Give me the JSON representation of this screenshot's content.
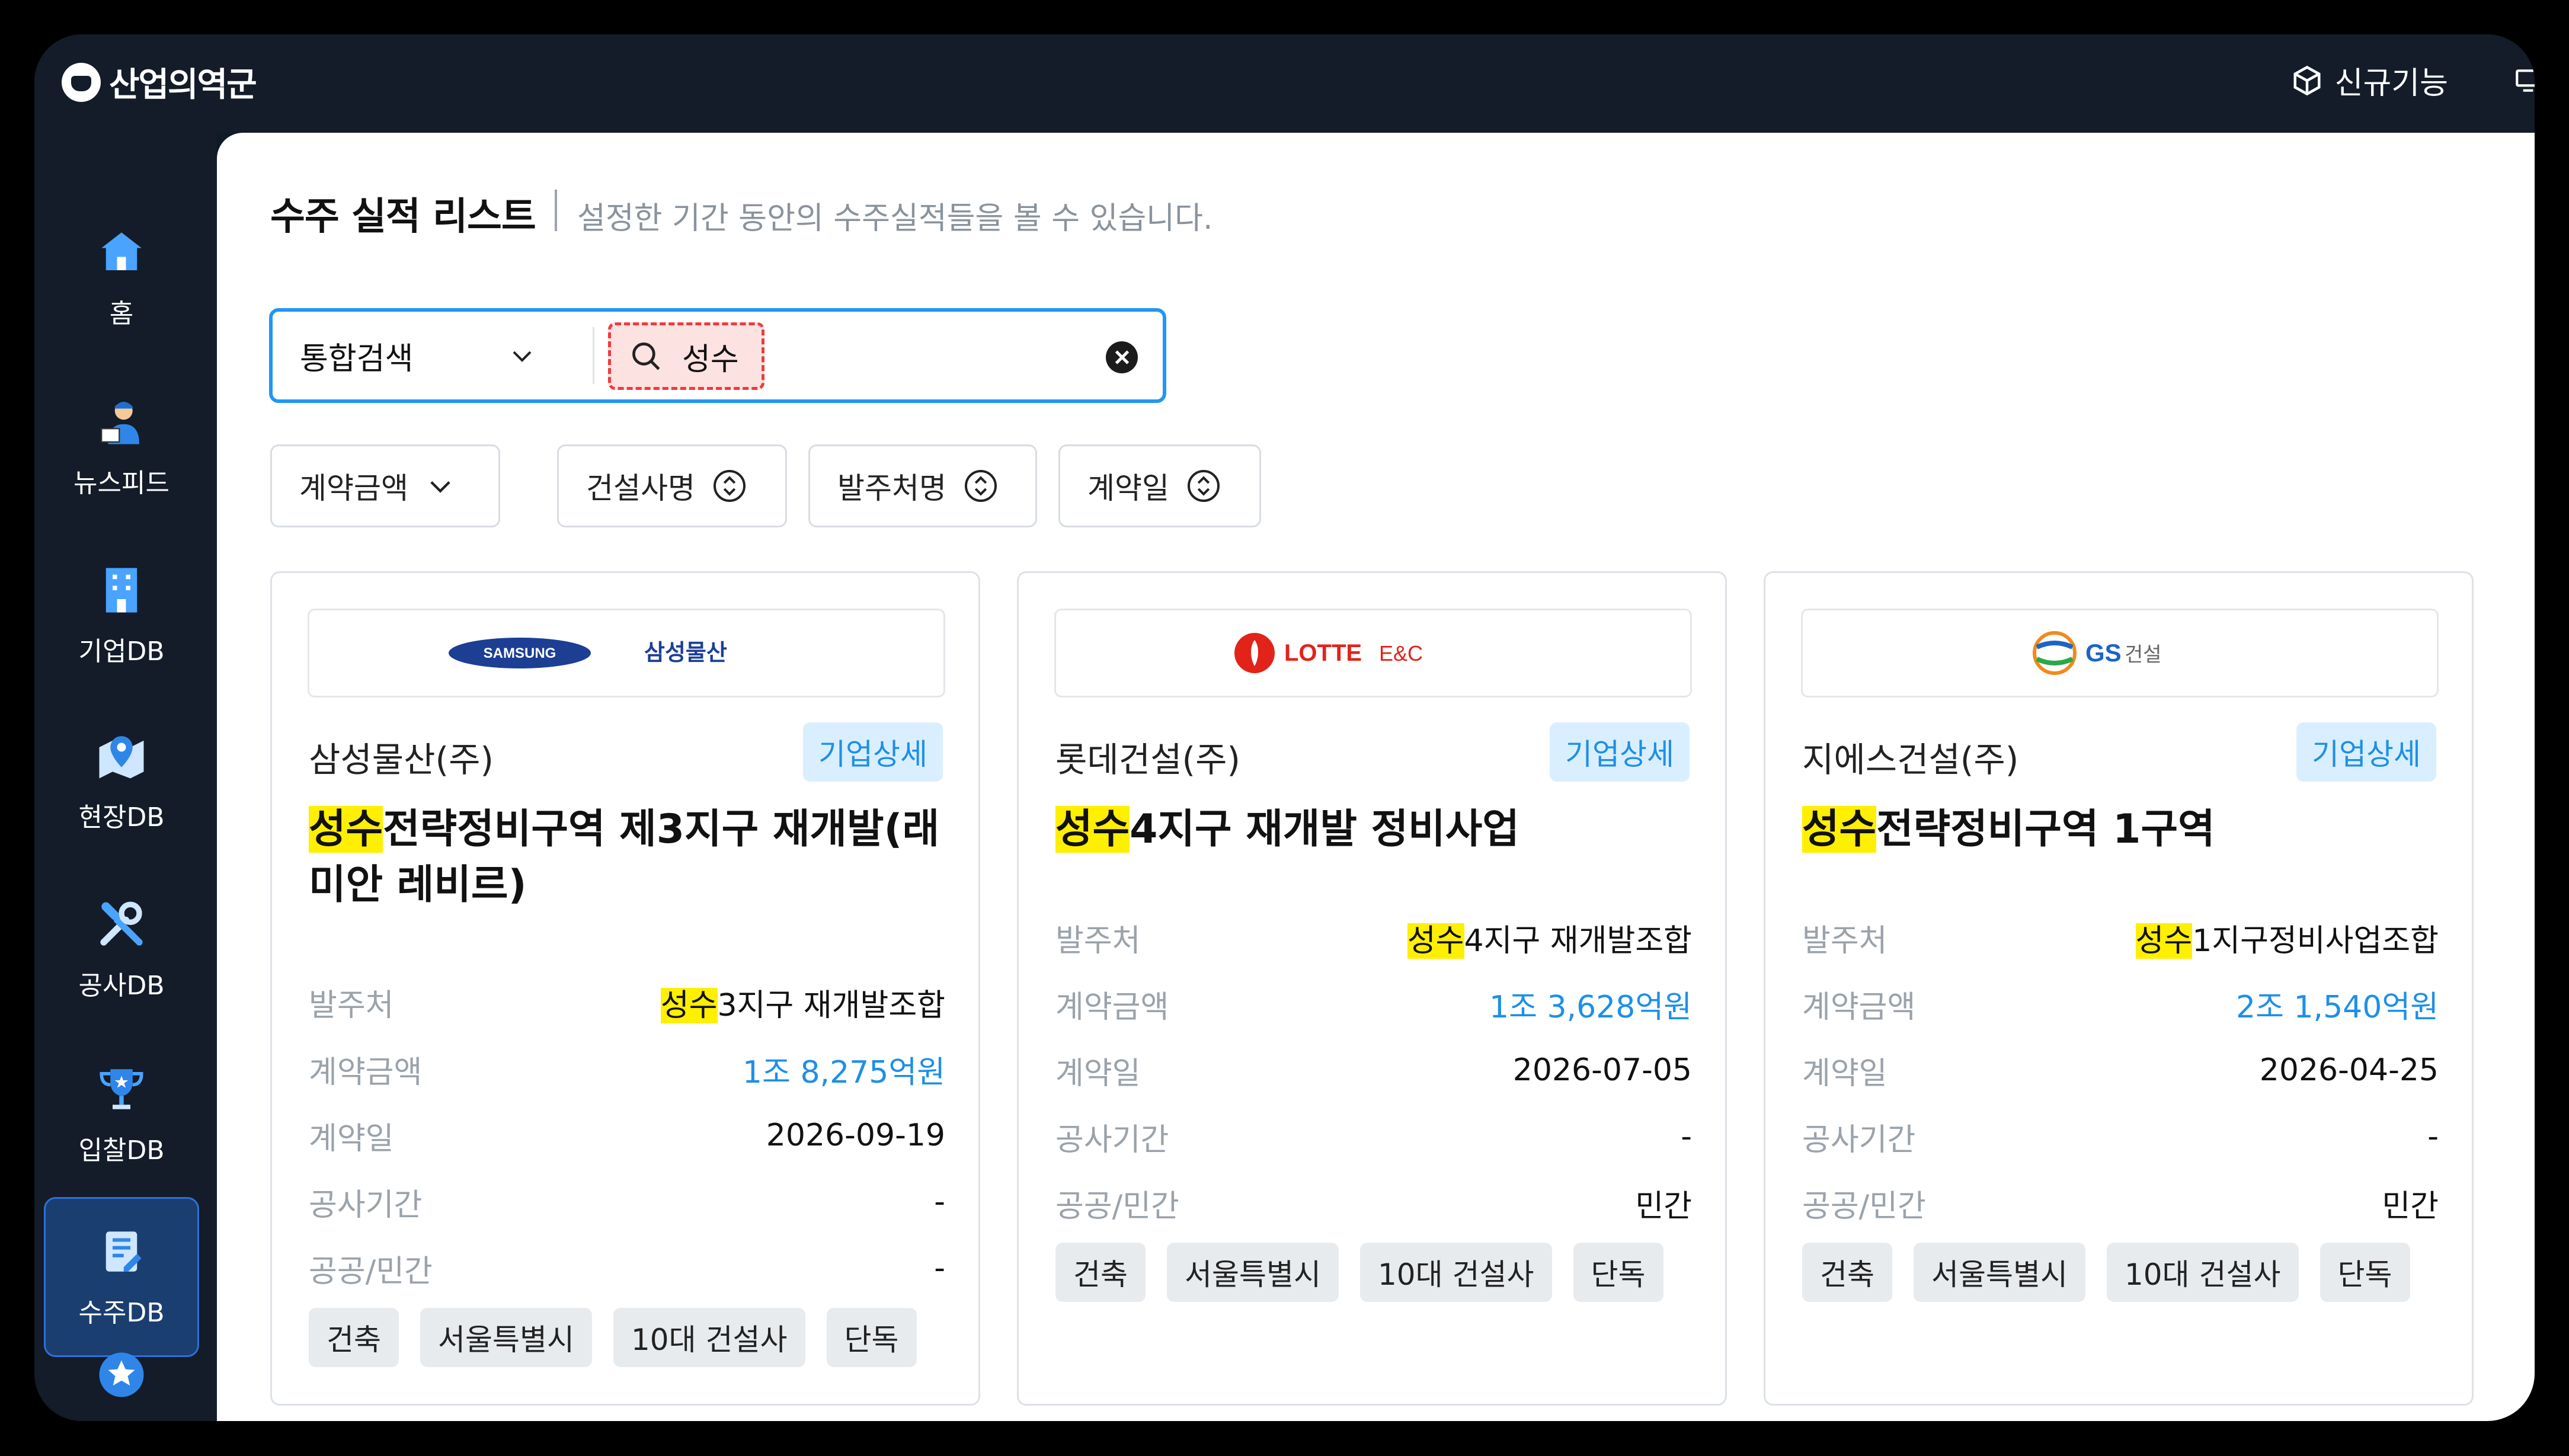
{
  "app": {
    "logo_text": "산업의역군"
  },
  "top": {
    "new_feature_label": "신규기능"
  },
  "sidebar": {
    "items": [
      {
        "label": "홈",
        "icon": "home-icon"
      },
      {
        "label": "뉴스피드",
        "icon": "news-icon"
      },
      {
        "label": "기업DB",
        "icon": "building-icon"
      },
      {
        "label": "현장DB",
        "icon": "map-pin-icon"
      },
      {
        "label": "공사DB",
        "icon": "tools-icon"
      },
      {
        "label": "입찰DB",
        "icon": "trophy-icon"
      },
      {
        "label": "수주DB",
        "icon": "document-icon"
      },
      {
        "label": "",
        "icon": "star-icon"
      }
    ],
    "active_index": 6
  },
  "page": {
    "title": "수주 실적 리스트",
    "subtitle": "설정한 기간 동안의 수주실적들을 볼 수 있습니다."
  },
  "search": {
    "scope": "통합검색",
    "query": "성수"
  },
  "filters": [
    {
      "label": "계약금액",
      "icon": "chevron-down-icon"
    },
    {
      "label": "건설사명",
      "icon": "sort-icon"
    },
    {
      "label": "발주처명",
      "icon": "sort-icon"
    },
    {
      "label": "계약일",
      "icon": "sort-icon"
    }
  ],
  "labels": {
    "detail": "기업상세",
    "client": "발주처",
    "amount": "계약금액",
    "date": "계약일",
    "period": "공사기간",
    "sector": "공공/민간"
  },
  "cards": [
    {
      "logo_brand": "SAMSUNG",
      "logo_name": "삼성물산",
      "company": "삼성물산(주)",
      "project_highlight": "성수",
      "project_rest": "전략정비구역 제3지구 재개발(래미안 레비르)",
      "client_highlight": "성수",
      "client_rest": "3지구 재개발조합",
      "amount": "1조 8,275억원",
      "date": "2026-09-19",
      "period": "-",
      "sector": "-",
      "tags": [
        "건축",
        "서울특별시",
        "10대 건설사",
        "단독"
      ]
    },
    {
      "logo_brand": "LOTTE",
      "logo_name": "E&C",
      "company": "롯데건설(주)",
      "project_highlight": "성수",
      "project_rest": "4지구 재개발 정비사업",
      "client_highlight": "성수",
      "client_rest": "4지구 재개발조합",
      "amount": "1조 3,628억원",
      "date": "2026-07-05",
      "period": "-",
      "sector": "민간",
      "tags": [
        "건축",
        "서울특별시",
        "10대 건설사",
        "단독"
      ]
    },
    {
      "logo_brand": "GS",
      "logo_name": "건설",
      "company": "지에스건설(주)",
      "project_highlight": "성수",
      "project_rest": "전략정비구역 1구역",
      "client_highlight": "성수",
      "client_rest": "1지구정비사업조합",
      "amount": "2조 1,540억원",
      "date": "2026-04-25",
      "period": "-",
      "sector": "민간",
      "tags": [
        "건축",
        "서울특별시",
        "10대 건설사",
        "단독"
      ]
    }
  ],
  "colors": {
    "accent": "#2196f3",
    "amount": "#1e8fe8",
    "highlight": "#ffef00",
    "sidebar_bg": "#131c28",
    "active_nav": "#1a3e6f"
  }
}
